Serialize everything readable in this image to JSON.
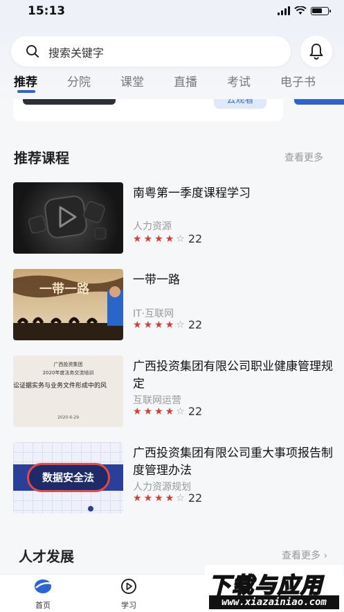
{
  "status_bar": {
    "time": "15:13"
  },
  "search": {
    "placeholder": "搜索关键字"
  },
  "tabs": [
    "推荐",
    "分院",
    "课堂",
    "直播",
    "考试",
    "电子书"
  ],
  "banner": {
    "button_label": "云观看"
  },
  "recommended": {
    "title": "推荐课程",
    "more": "查看更多",
    "courses": [
      {
        "title": "南粤第一季度课程学习",
        "category": "人力资源",
        "stars": 4,
        "max_stars": 5,
        "count": "22",
        "thumb_text": ""
      },
      {
        "title": "一带一路",
        "category": "IT·互联网",
        "stars": 4,
        "max_stars": 5,
        "count": "22",
        "thumb_text": "一带一路"
      },
      {
        "title": "广西投资集团有限公司职业健康管理规定",
        "category": "互联网运营",
        "stars": 4,
        "max_stars": 5,
        "count": "22",
        "thumb_lines": [
          "广西投资集团",
          "2020年度法务交流培训",
          "讼证据实务与业务文件形成中的风",
          "2020-6-29"
        ]
      },
      {
        "title": "广西投资集团有限公司重大事项报告制度管理办法",
        "category": "人力资源规划",
        "stars": 4,
        "max_stars": 5,
        "count": "22",
        "thumb_text": "数据安全法"
      }
    ]
  },
  "talent": {
    "title": "人才发展",
    "more": "查看更多"
  },
  "bottom_nav": [
    {
      "label": "首页",
      "icon": "home-logo-icon"
    },
    {
      "label": "学习",
      "icon": "play-circle-icon"
    }
  ],
  "watermark": {
    "top": "下载与应用",
    "bottom": "www.xiazainiao.com"
  },
  "colors": {
    "accent": "#2b64d9",
    "star": "#d63b36"
  }
}
